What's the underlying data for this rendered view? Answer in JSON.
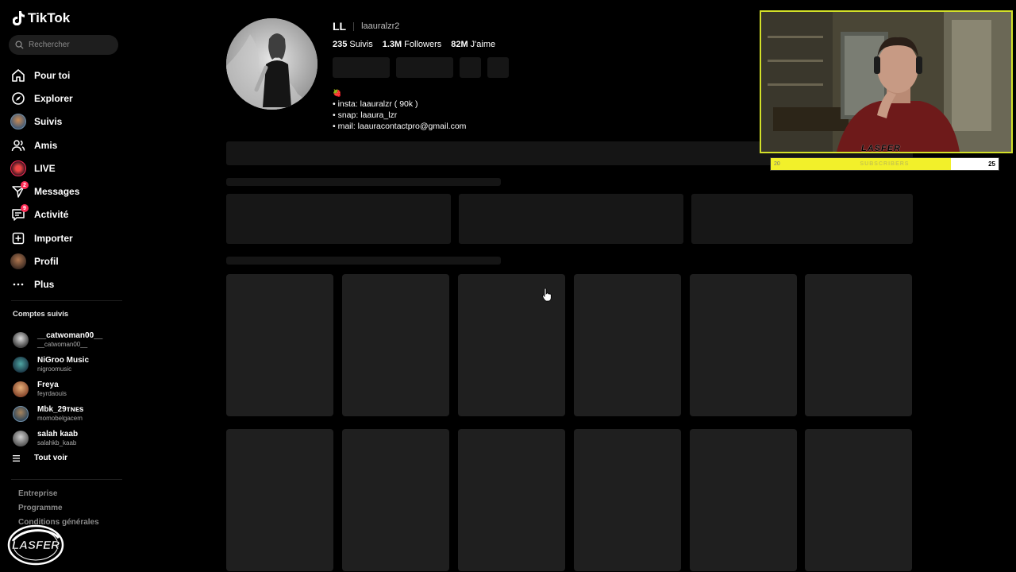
{
  "app": {
    "logo_text": "TikTok"
  },
  "search": {
    "placeholder": "Rechercher"
  },
  "nav": {
    "items": [
      {
        "label": "Pour toi"
      },
      {
        "label": "Explorer"
      },
      {
        "label": "Suivis"
      },
      {
        "label": "Amis"
      },
      {
        "label": "LIVE"
      },
      {
        "label": "Messages",
        "badge": "2"
      },
      {
        "label": "Activité",
        "badge": "9"
      },
      {
        "label": "Importer"
      },
      {
        "label": "Profil"
      },
      {
        "label": "Plus"
      }
    ]
  },
  "following": {
    "title": "Comptes suivis",
    "accounts": [
      {
        "name": "__catwoman00__",
        "username": "__catwoman00__"
      },
      {
        "name": "NiGroo Music",
        "username": "nigroomusic"
      },
      {
        "name": "Freya",
        "username": "feyrdaouis"
      },
      {
        "name": "Mbk_29ᴛɴᴇs",
        "username": "momobelgacem"
      },
      {
        "name": "salah kaab",
        "username": "salahkb_kaab"
      }
    ],
    "see_all": "Tout voir"
  },
  "footer": {
    "links": [
      "Entreprise",
      "Programme",
      "Conditions générales"
    ]
  },
  "profile": {
    "display_name": "LL",
    "username": "laauralzr2",
    "stats": [
      {
        "value": "235",
        "label": "Suivis"
      },
      {
        "value": "1.3M",
        "label": "Followers"
      },
      {
        "value": "82M",
        "label": "J'aime"
      }
    ],
    "bio": {
      "emoji": "🍓",
      "lines": [
        "• insta: laauralzr ( 90k )",
        "• snap: laaura_lzr",
        "• mail: laauracontactpro@gmail.com"
      ]
    }
  },
  "overlay": {
    "webcam_label": "LASFER",
    "subscribers": {
      "left": "20",
      "label": "SUBSCRIBERS",
      "goal": "25",
      "progress": 0.79
    },
    "watermark": "LASFER"
  },
  "colors": {
    "accent": "#fe2c55",
    "webcam_border": "#d3e029",
    "sub_fill": "#f2f02a"
  }
}
